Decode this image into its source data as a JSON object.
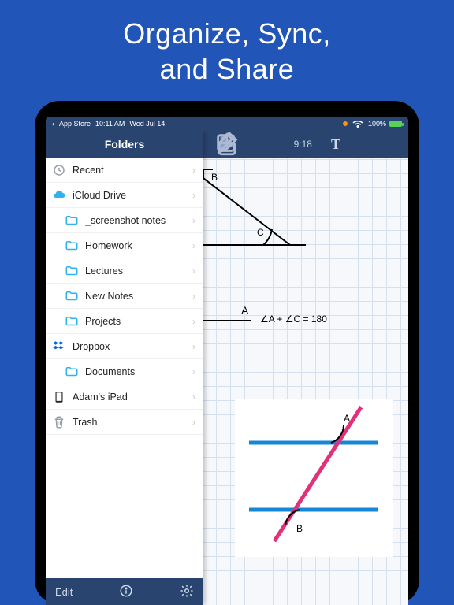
{
  "hero": {
    "line1": "Organize, Sync,",
    "line2": "and Share"
  },
  "statusbar": {
    "back": "App Store",
    "time": "10:11 AM",
    "date": "Wed Jul 14",
    "battery": "100%"
  },
  "sidebar": {
    "title": "Folders",
    "items": [
      {
        "icon": "clock",
        "label": "Recent",
        "indent": false
      },
      {
        "icon": "icloud",
        "label": "iCloud Drive",
        "indent": false
      },
      {
        "icon": "folder",
        "label": "_screenshot notes",
        "indent": true
      },
      {
        "icon": "folder",
        "label": "Homework",
        "indent": true
      },
      {
        "icon": "folder",
        "label": "Lectures",
        "indent": true
      },
      {
        "icon": "folder",
        "label": "New Notes",
        "indent": true
      },
      {
        "icon": "folder",
        "label": "Projects",
        "indent": true
      },
      {
        "icon": "dropbox",
        "label": "Dropbox",
        "indent": false
      },
      {
        "icon": "folder",
        "label": "Documents",
        "indent": true
      },
      {
        "icon": "ipad",
        "label": "Adam's iPad",
        "indent": false
      },
      {
        "icon": "trash",
        "label": "Trash",
        "indent": false
      }
    ],
    "footer": {
      "edit": "Edit"
    }
  },
  "toolbar": {
    "time": "9:18",
    "text_tool": "T"
  },
  "canvas": {
    "labels": {
      "A": "A",
      "B": "B",
      "C": "C",
      "A2": "A",
      "B2": "B"
    },
    "equation": "∠A + ∠C = 180"
  }
}
